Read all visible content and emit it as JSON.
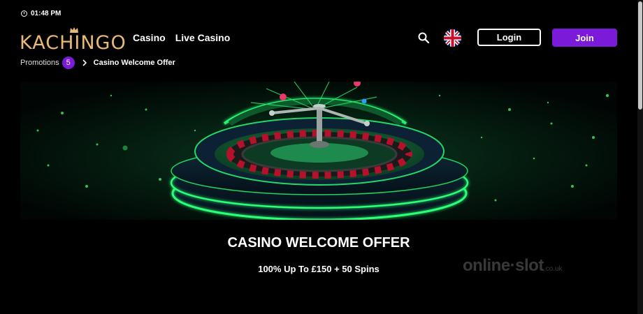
{
  "status_bar": {
    "time": "01:48 PM"
  },
  "header": {
    "logo_text": "KACHINGO",
    "nav": [
      "Casino",
      "Live Casino"
    ],
    "login_label": "Login",
    "join_label": "Join",
    "icons": [
      "clock-icon",
      "search-icon",
      "uk-flag-icon",
      "crown-icon"
    ]
  },
  "breadcrumb": {
    "parent": "Promotions",
    "parent_count": "5",
    "current": "Casino Welcome Offer"
  },
  "promo": {
    "title": "CASINO WELCOME OFFER",
    "subtitle": "100% Up To £150 + 50 Spins",
    "banner_image": "roulette-wheel-neon-green"
  },
  "watermark": {
    "text": "online·slot",
    "suffix": ".co.uk"
  },
  "colors": {
    "brand_gold": "#e8b978",
    "accent_purple": "#7b1ad9",
    "background": "#000000",
    "neon_green": "#22e06a"
  }
}
